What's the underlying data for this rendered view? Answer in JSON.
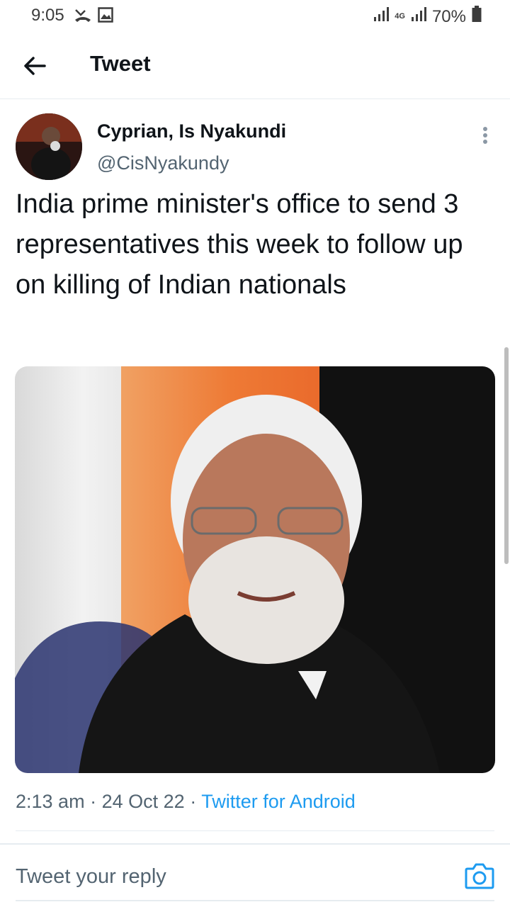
{
  "status_bar": {
    "time": "9:05",
    "network": "4G",
    "battery": "70%",
    "icons": [
      "missed-call-icon",
      "image-icon",
      "signal-icon",
      "battery-icon"
    ]
  },
  "header": {
    "title": "Tweet",
    "back_icon": "arrow-left-icon"
  },
  "tweet": {
    "author": {
      "display_name": "Cyprian, Is Nyakundi",
      "handle": "@CisNyakundy"
    },
    "text": "India prime minister's office to send 3 representatives this week to follow up on killing of Indian nationals",
    "timestamp": "2:13 am",
    "date": "24 Oct 22",
    "separator": "·",
    "source": "Twitter for Android",
    "media_icon": "photo"
  },
  "reply": {
    "placeholder": "Tweet your reply",
    "camera_icon": "camera-icon"
  },
  "colors": {
    "accent": "#1d9bf0",
    "text_primary": "#0f1419",
    "text_secondary": "#536471",
    "border": "#e6ecf0"
  }
}
